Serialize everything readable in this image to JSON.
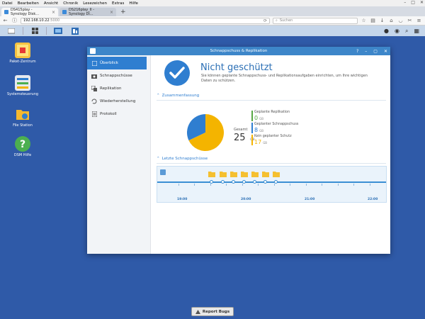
{
  "browser": {
    "menu": [
      "Datei",
      "Bearbeiten",
      "Ansicht",
      "Chronik",
      "Lesezeichen",
      "Extras",
      "Hilfe"
    ],
    "tabs": [
      {
        "label": "DS415play - Synology Disk..."
      },
      {
        "label": "DS216play_II - Synology Di..."
      }
    ],
    "url_host": "192.168.10.22",
    "url_port": ":5000",
    "search_placeholder": "Suchen"
  },
  "desktop": {
    "icons": [
      {
        "label": "Paket-Zentrum"
      },
      {
        "label": "Systemsteuerung"
      },
      {
        "label": "File Station"
      },
      {
        "label": "DSM Hilfe"
      }
    ]
  },
  "window": {
    "title": "Schnappschuss & Replikation",
    "sidebar": [
      {
        "label": "Überblick",
        "active": true
      },
      {
        "label": "Schnappschüsse"
      },
      {
        "label": "Replikation"
      },
      {
        "label": "Wiederherstellung"
      },
      {
        "label": "Protokoll"
      }
    ],
    "status_title": "Nicht geschützt",
    "status_desc": "Sie können geplante Schnappschuss- und Replikationsaufgaben einrichten, um Ihre wichtigen Daten zu schützen.",
    "summary_header": "Zusammenfassung",
    "total_label": "Gesamt",
    "total_value": "25",
    "total_unit": "GB",
    "legend": [
      {
        "label": "Geplante Replikation",
        "value": "0",
        "unit": "GB",
        "color": "#57a843"
      },
      {
        "label": "Geplanter Schnappschuss",
        "value": "8",
        "unit": "GB",
        "color": "#2f7ed0"
      },
      {
        "label": "Kein geplanter Schutz",
        "value": "17",
        "unit": "GB",
        "color": "#f4b400"
      }
    ],
    "recent_header": "Letzte Schnappschüsse",
    "timeline_labels": [
      "19:00",
      "20:00",
      "21:00",
      "22:00"
    ]
  },
  "chart_data": {
    "type": "pie",
    "categories": [
      "Geplanter Schnappschuss",
      "Kein geplanter Schutz",
      "Geplante Replikation"
    ],
    "values": [
      8,
      17,
      0
    ],
    "colors": [
      "#2f7ed0",
      "#f4b400",
      "#57a843"
    ]
  },
  "footer": {
    "report_label": "Report Bugs"
  }
}
